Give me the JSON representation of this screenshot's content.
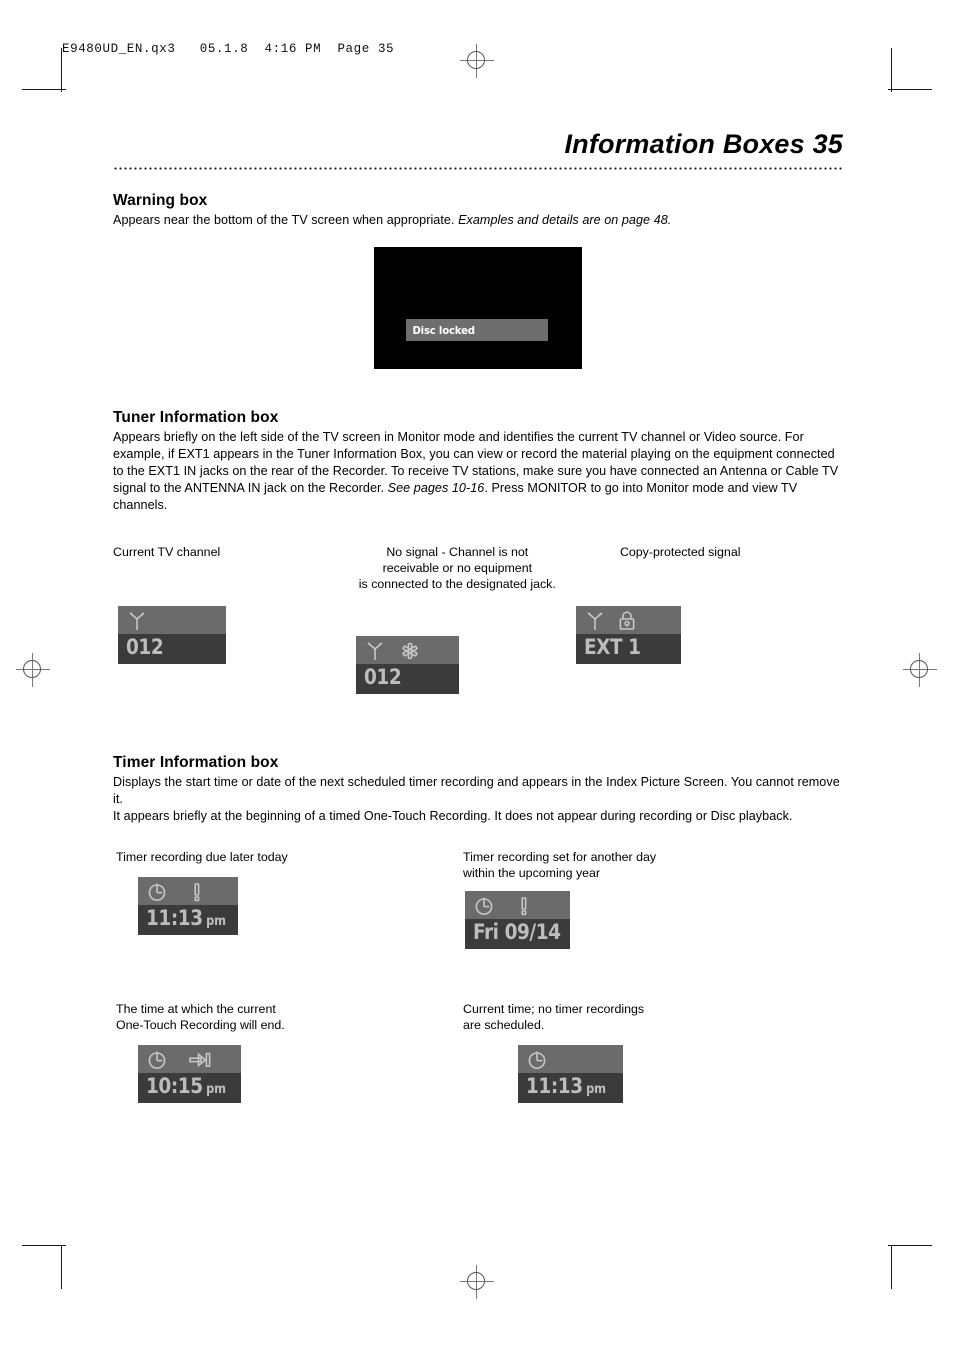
{
  "printer_slug": "E9480UD_EN.qx3   05.1.8  4:16 PM  Page 35",
  "page": {
    "title": "Information Boxes  35",
    "number": "35"
  },
  "sections": {
    "warning": {
      "heading": "Warning box",
      "body_plain": "Appears near the bottom of the TV screen when appropriate. ",
      "body_italic": "Examples and details are on page 48.",
      "tv_example": {
        "message": "Disc locked",
        "screen_color": "#000000",
        "bar_color": "#6e6e6e",
        "text_color": "#ffffff"
      }
    },
    "tuner": {
      "heading": "Tuner Information box",
      "body": "Appears briefly on the left side of the TV screen in Monitor mode and identifies the current TV channel or Video source. For example, if EXT1 appears in the Tuner Information Box, you can view or record the material playing on the equipment connected to the EXT1 IN jacks on the rear of the Recorder. To receive TV stations, make sure you have connected an Antenna or Cable TV signal to the ANTENNA IN jack on the Recorder. ",
      "body_italic": "See pages 10-16",
      "body_tail": ". Press MONITOR to go into Monitor mode and view TV channels.",
      "examples": [
        {
          "caption": "Current TV channel",
          "icons": [
            "antenna-icon"
          ],
          "value": "012"
        },
        {
          "caption_lines": [
            "No signal - Channel is not",
            "receivable or no equipment",
            "is connected to the designated jack."
          ],
          "icons": [
            "antenna-icon",
            "no-signal-asterisk-icon"
          ],
          "value": "012"
        },
        {
          "caption": "Copy-protected signal",
          "icons": [
            "antenna-icon",
            "padlock-icon"
          ],
          "value": "EXT 1"
        }
      ]
    },
    "timer": {
      "heading": "Timer Information box",
      "body_p1": "Displays the start time or date of the next scheduled timer recording and appears in the Index Picture Screen. You cannot remove it.",
      "body_p2": "It appears briefly at the beginning of a timed One-Touch Recording. It does not appear during recording or Disc playback.",
      "examples": [
        {
          "caption_lines": [
            "Timer recording due later today"
          ],
          "icons": [
            "clock-icon",
            "exclamation-icon"
          ],
          "value": "11:13",
          "suffix": "pm"
        },
        {
          "caption_lines": [
            "Timer recording set for another day",
            "within the upcoming year"
          ],
          "icons": [
            "clock-icon",
            "exclamation-icon"
          ],
          "value": "Fri 09/14",
          "suffix": ""
        },
        {
          "caption_lines": [
            "The time at which the current",
            "One-Touch Recording will end."
          ],
          "icons": [
            "clock-icon",
            "arrow-to-end-icon"
          ],
          "value": "10:15",
          "suffix": "pm"
        },
        {
          "caption_lines": [
            "Current time; no timer recordings",
            "are scheduled."
          ],
          "icons": [
            "clock-icon"
          ],
          "value": "11:13",
          "suffix": "pm"
        }
      ]
    }
  },
  "colors": {
    "osd_top": "#6b6b6b",
    "osd_bottom": "#3b3b3b",
    "osd_text": "#bdbdbd",
    "icon_stroke": "#c6c6c6"
  }
}
